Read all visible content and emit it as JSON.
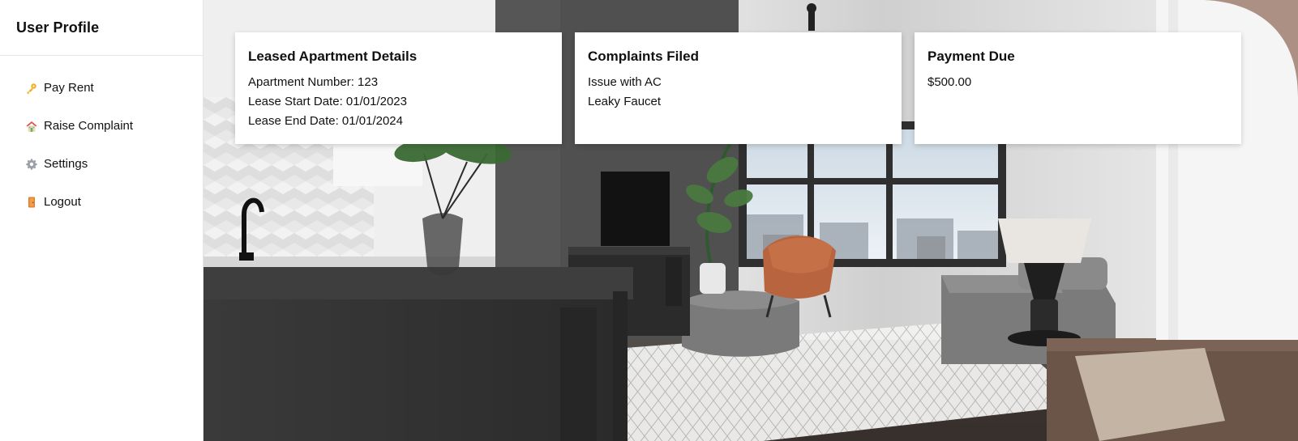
{
  "sidebar": {
    "title": "User Profile",
    "items": [
      {
        "label": "Pay Rent",
        "icon": "key-icon"
      },
      {
        "label": "Raise Complaint",
        "icon": "house-icon"
      },
      {
        "label": "Settings",
        "icon": "gear-icon"
      },
      {
        "label": "Logout",
        "icon": "door-icon"
      }
    ]
  },
  "cards": {
    "lease": {
      "title": "Leased Apartment Details",
      "lines": [
        "Apartment Number: 123",
        "Lease Start Date: 01/01/2023",
        "Lease End Date: 01/01/2024"
      ]
    },
    "complaints": {
      "title": "Complaints Filed",
      "lines": [
        "Issue with AC",
        "Leaky Faucet"
      ]
    },
    "payment": {
      "title": "Payment Due",
      "lines": [
        "$500.00"
      ]
    }
  },
  "colors": {
    "sidebar_bg": "#ffffff",
    "card_bg": "#ffffff",
    "text": "#111111"
  }
}
